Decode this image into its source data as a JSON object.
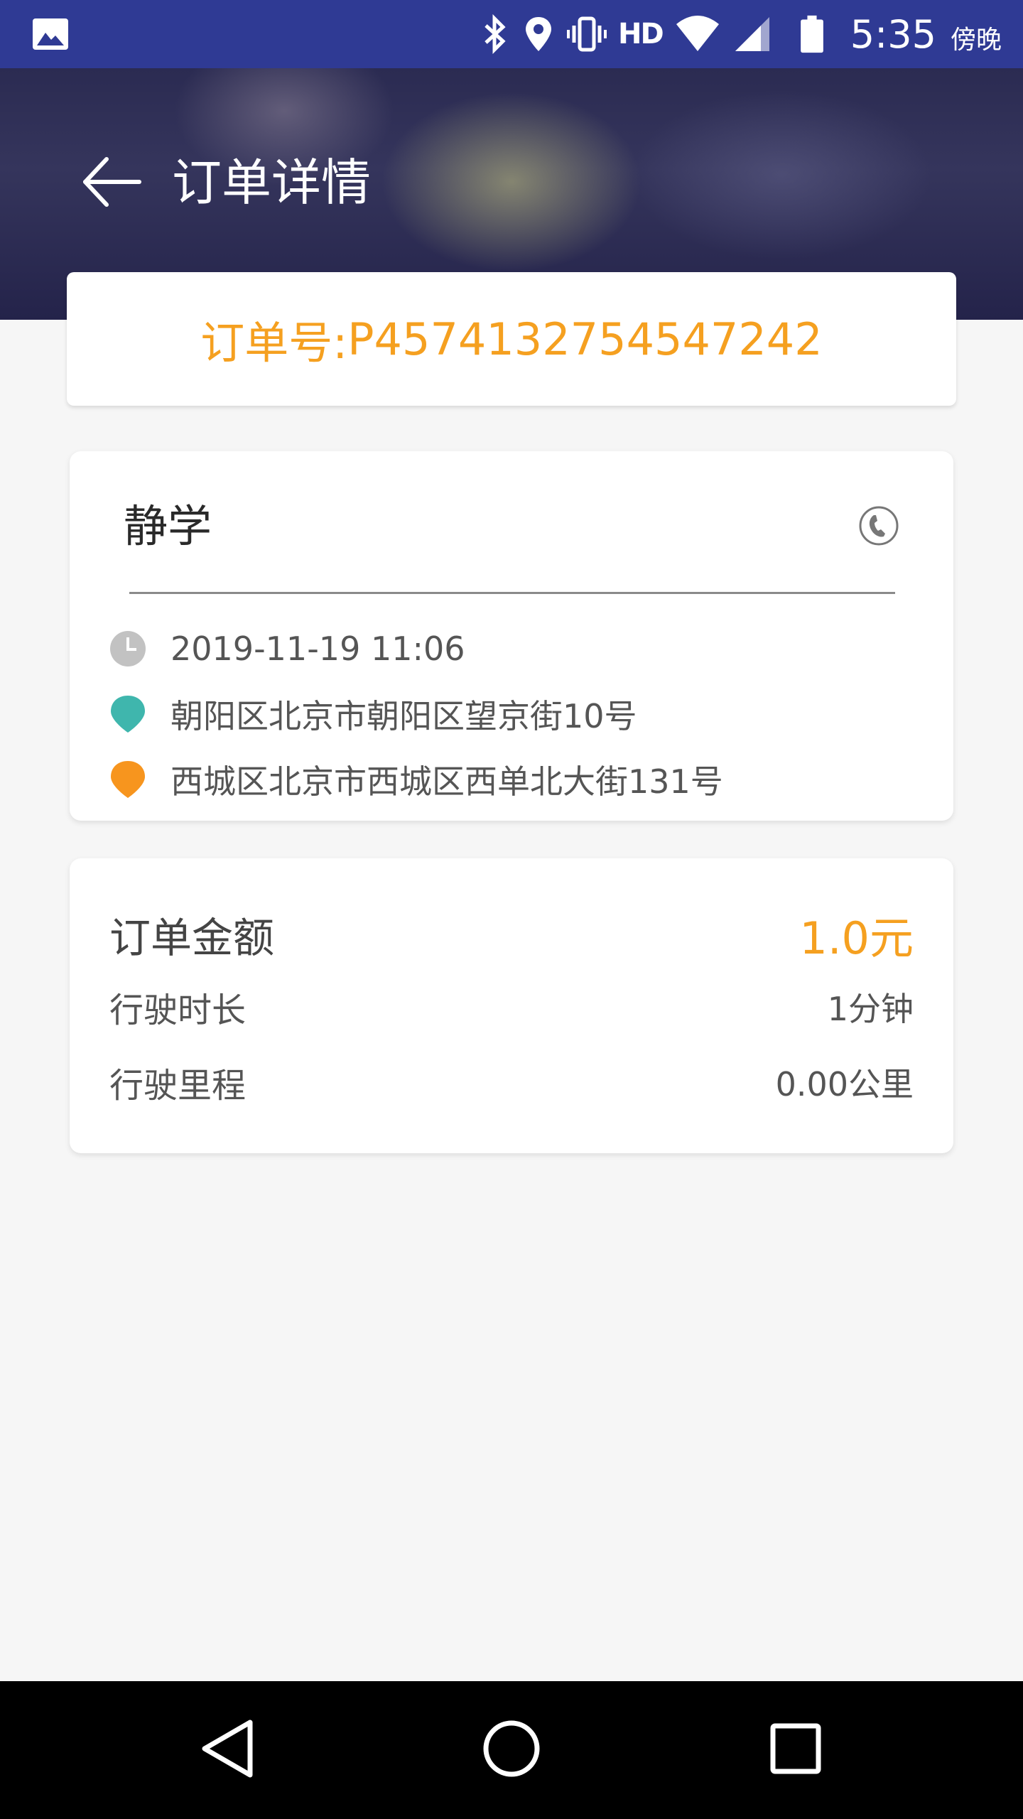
{
  "status_bar": {
    "time": "5:35",
    "period": "傍晚",
    "network_label": "HD",
    "icons": [
      "gallery-icon",
      "bluetooth-icon",
      "location-icon",
      "vibrate-icon",
      "wifi-icon",
      "signal-icon",
      "battery-icon"
    ]
  },
  "header": {
    "title": "订单详情",
    "back_icon": "arrow-left-icon"
  },
  "order": {
    "label": "订单号: ",
    "number": "P4574132754547242"
  },
  "trip": {
    "passenger_name": "静学",
    "phone_icon": "phone-icon",
    "time": "2019-11-19  11:06",
    "origin": "朝阳区北京市朝阳区望京街10号",
    "destination": "西城区北京市西城区西单北大街131号",
    "origin_color": "#3fb6ad",
    "destination_color": "#f7951e"
  },
  "fare": {
    "total_label": "订单金额",
    "total_value": "1.0元",
    "duration_label": "行驶时长",
    "duration_value": "1分钟",
    "distance_label": "行驶里程",
    "distance_value": "0.00公里"
  },
  "nav_bar": {
    "icons": [
      "back-triangle-icon",
      "home-circle-icon",
      "recents-square-icon"
    ]
  },
  "colors": {
    "status_bar": "#2f3a94",
    "accent": "#f5a020",
    "background": "#f6f6f6"
  }
}
